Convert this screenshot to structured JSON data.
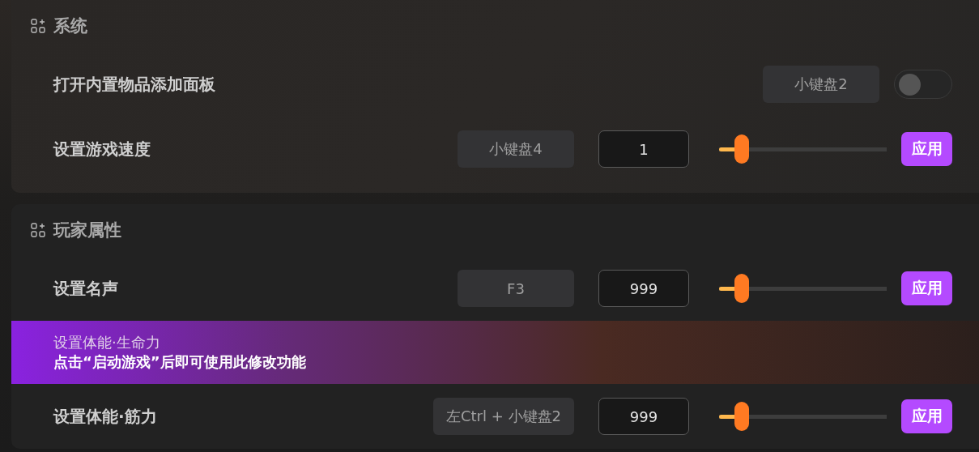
{
  "sections": [
    {
      "title": "系统",
      "rows": [
        {
          "kind": "toggle",
          "label": "打开内置物品添加面板",
          "hotkey": "小键盘2",
          "on": false
        },
        {
          "kind": "slider",
          "label": "设置游戏速度",
          "hotkey": "小键盘4",
          "value": "1",
          "level": 0.1,
          "button": "应用"
        }
      ]
    },
    {
      "title": "玩家属性",
      "rows": [
        {
          "kind": "slider",
          "label": "设置名声",
          "hotkey": "F3",
          "value": "999",
          "level": 0.1,
          "button": "应用"
        },
        {
          "kind": "notice",
          "label": "设置体能·生命力",
          "message": "点击“启动游戏”后即可使用此修改功能"
        },
        {
          "kind": "slider",
          "label": "设置体能·筋力",
          "hotkey": "左Ctrl + 小键盘2",
          "value": "999",
          "level": 0.1,
          "button": "应用"
        }
      ]
    }
  ]
}
